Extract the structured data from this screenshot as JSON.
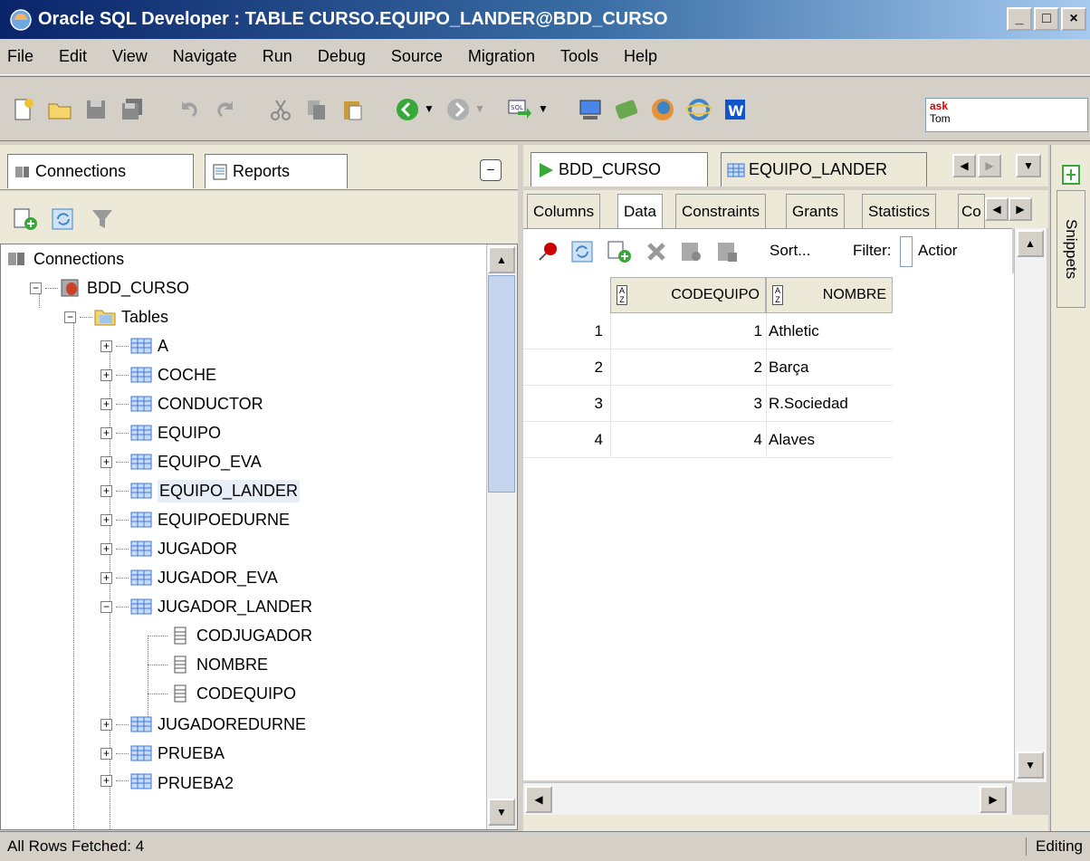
{
  "window": {
    "title": "Oracle SQL Developer : TABLE CURSO.EQUIPO_LANDER@BDD_CURSO",
    "minimize": "_",
    "maximize": "□",
    "close": "×"
  },
  "menu": [
    "File",
    "Edit",
    "View",
    "Navigate",
    "Run",
    "Debug",
    "Source",
    "Migration",
    "Tools",
    "Help"
  ],
  "toolbar": {
    "icons": [
      "new-icon",
      "open-icon",
      "save-icon",
      "save-all-icon",
      "undo-icon",
      "redo-icon",
      "cut-icon",
      "copy-icon",
      "paste-icon",
      "back-icon",
      "forward-icon",
      "sql-worksheet-icon",
      "monitor-icon",
      "oracle-icon",
      "firefox-icon",
      "ie-icon",
      "word-icon"
    ],
    "ask_label": "ask",
    "tom_label": "Tom"
  },
  "left_panel": {
    "tabs": [
      {
        "label": "Connections"
      },
      {
        "label": "Reports"
      }
    ],
    "tree": {
      "root": "Connections",
      "connection": "BDD_CURSO",
      "tables_label": "Tables",
      "tables": [
        "A",
        "COCHE",
        "CONDUCTOR",
        "EQUIPO",
        "EQUIPO_EVA",
        "EQUIPO_LANDER",
        "EQUIPOEDURNE",
        "JUGADOR",
        "JUGADOR_EVA",
        "JUGADOR_LANDER"
      ],
      "columns": [
        "CODJUGADOR",
        "NOMBRE",
        "CODEQUIPO"
      ],
      "tables_after": [
        "JUGADOREDURNE",
        "PRUEBA",
        "PRUEBA2"
      ],
      "selected": "EQUIPO_LANDER"
    }
  },
  "right_panel": {
    "editor_tabs": [
      {
        "label": "BDD_CURSO"
      },
      {
        "label": "EQUIPO_LANDER"
      }
    ],
    "sub_tabs": [
      "Columns",
      "Data",
      "Constraints",
      "Grants",
      "Statistics",
      "Co"
    ],
    "active_sub_tab": "Data",
    "data_toolbar": {
      "sort": "Sort...",
      "filter": "Filter:",
      "actions": "Actior"
    },
    "grid": {
      "columns": [
        "CODEQUIPO",
        "NOMBRE"
      ],
      "rows": [
        {
          "row": "1",
          "codequipo": "1",
          "nombre": "Athletic"
        },
        {
          "row": "2",
          "codequipo": "2",
          "nombre": "Barça"
        },
        {
          "row": "3",
          "codequipo": "3",
          "nombre": "R.Sociedad"
        },
        {
          "row": "4",
          "codequipo": "4",
          "nombre": "Alaves"
        }
      ]
    },
    "snippets_label": "Snippets"
  },
  "status": {
    "message": "All Rows Fetched: 4",
    "mode": "Editing"
  }
}
